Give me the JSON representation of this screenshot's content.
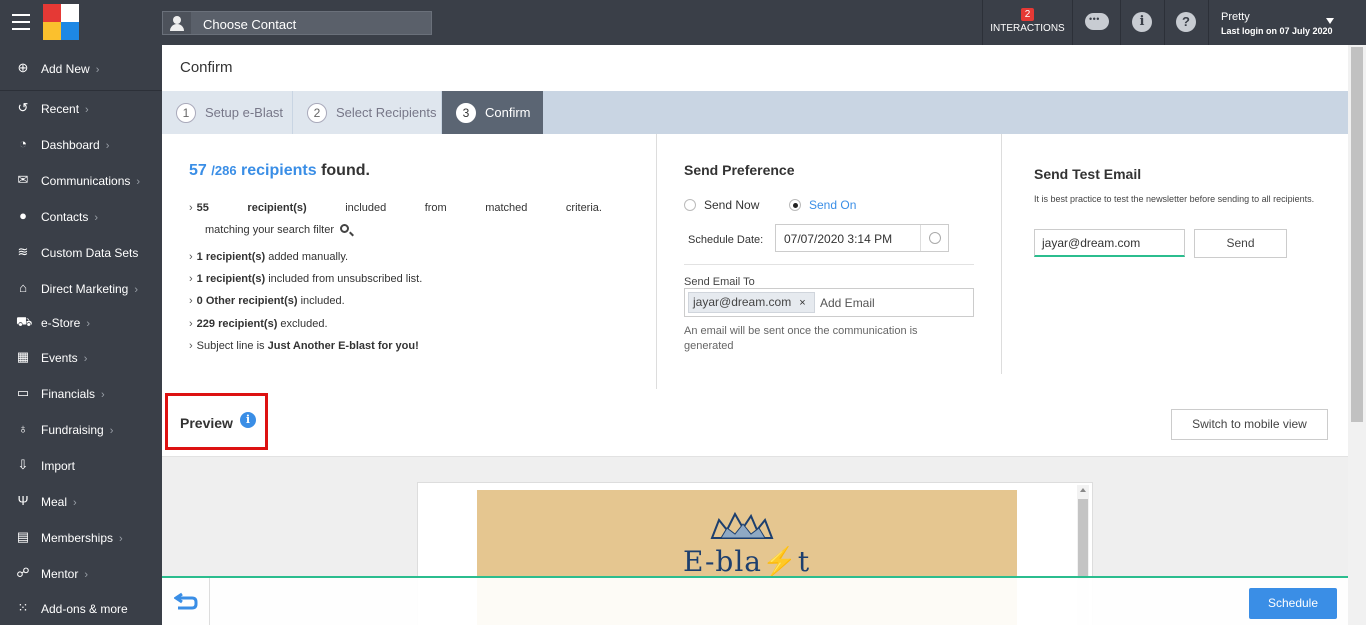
{
  "header": {
    "choose_contact": "Choose Contact",
    "interactions_count": "2",
    "interactions_label": "INTERACTIONS",
    "user_name": "Pretty",
    "last_login": "Last login on 07 July 2020"
  },
  "sidebar": {
    "items": [
      {
        "label": "Add New",
        "chev": "›"
      },
      {
        "label": "Recent",
        "chev": "›"
      },
      {
        "label": "Dashboard",
        "chev": "›"
      },
      {
        "label": "Communications",
        "chev": "›"
      },
      {
        "label": "Contacts",
        "chev": "›"
      },
      {
        "label": "Custom Data Sets",
        "chev": ""
      },
      {
        "label": "Direct Marketing",
        "chev": "›"
      },
      {
        "label": "e-Store",
        "chev": "›"
      },
      {
        "label": "Events",
        "chev": "›"
      },
      {
        "label": "Financials",
        "chev": "›"
      },
      {
        "label": "Fundraising",
        "chev": "›"
      },
      {
        "label": "Import",
        "chev": ""
      },
      {
        "label": "Meal",
        "chev": "›"
      },
      {
        "label": "Memberships",
        "chev": "›"
      },
      {
        "label": "Mentor",
        "chev": "›"
      },
      {
        "label": "Add-ons & more",
        "chev": ""
      }
    ]
  },
  "page": {
    "title": "Confirm"
  },
  "steps": [
    {
      "num": "1",
      "label": "Setup e-Blast"
    },
    {
      "num": "2",
      "label": "Select Recipients"
    },
    {
      "num": "3",
      "label": "Confirm"
    }
  ],
  "summary": {
    "count": "57",
    "total": "/286",
    "recipients_word": "recipients",
    "found": "found.",
    "line1": {
      "num": "55",
      "w1": "recipient(s)",
      "w2": "included",
      "w3": "from",
      "w4": "matched",
      "w5": "criteria."
    },
    "line1b": "matching your search filter",
    "line2_bold": "1 recipient(s)",
    "line2_rest": " added manually.",
    "line3_bold": "1 recipient(s)",
    "line3_rest": " included from unsubscribed list.",
    "line4_bold": "0 Other recipient(s)",
    "line4_rest": " included.",
    "line5_bold": "229 recipient(s)",
    "line5_rest": " excluded.",
    "line6_pre": "Subject line is ",
    "line6_bold": "Just Another E-blast for you!"
  },
  "preference": {
    "title": "Send Preference",
    "send_now": "Send Now",
    "send_on": "Send On",
    "schedule_label": "Schedule Date:",
    "schedule_value": "07/07/2020 3:14 PM",
    "send_to_label": "Send Email To",
    "chip": "jayar@dream.com",
    "chip_remove": "×",
    "add_email": "Add Email",
    "note": "An email will be sent once the communication is generated"
  },
  "test_email": {
    "title": "Send Test Email",
    "note": "It is best practice to test the newsletter before sending to all recipients.",
    "value": "jayar@dream.com",
    "send": "Send"
  },
  "preview": {
    "label": "Preview",
    "mobile_button": "Switch to mobile view",
    "banner_text": "E-bla⚡t"
  },
  "footer": {
    "schedule": "Schedule"
  },
  "colors": {
    "accent": "#3a8ee6",
    "topbar": "#3a3f48",
    "highlight": "#dd1111",
    "green": "#2bbd8e"
  }
}
